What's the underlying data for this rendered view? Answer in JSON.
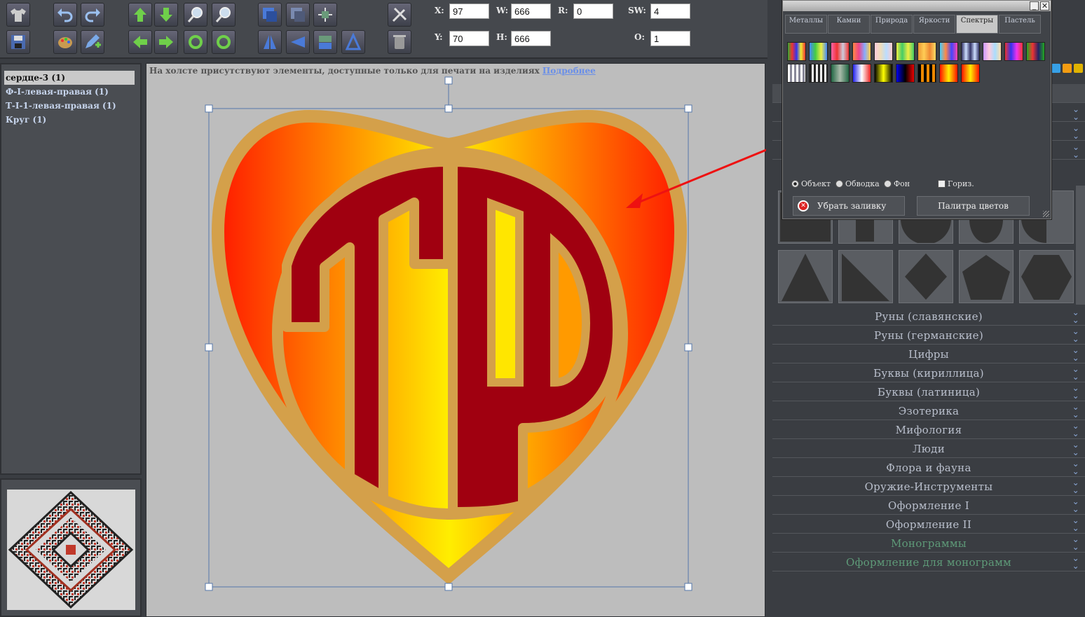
{
  "toolbar": {
    "fields": {
      "x": {
        "label": "X:",
        "value": "97"
      },
      "y": {
        "label": "Y:",
        "value": "70"
      },
      "w": {
        "label": "W:",
        "value": "666"
      },
      "h": {
        "label": "H:",
        "value": "666"
      },
      "r": {
        "label": "R:",
        "value": "0"
      },
      "sw": {
        "label": "SW:",
        "value": "4"
      },
      "o": {
        "label": "O:",
        "value": "1"
      }
    },
    "icons": [
      "shirt-icon",
      "undo-icon",
      "redo-icon",
      "move-up-icon",
      "move-down-icon",
      "zoom-in-icon",
      "zoom-out-icon",
      "bring-front-icon",
      "send-back-icon",
      "align-icon",
      "tools-icon",
      "save-icon",
      "palette-icon",
      "edit-add-icon",
      "move-left-icon",
      "move-right-icon",
      "rotate-cw-icon",
      "rotate-ccw-icon",
      "flip-horizontal-icon",
      "flip-left-icon",
      "flip-vertical-icon",
      "flip-right-icon",
      "trash-icon"
    ]
  },
  "layers": {
    "items": [
      {
        "label": "сердце-3 (1)",
        "selected": true
      },
      {
        "label": "Ф-I-левая-правая (1)",
        "selected": false
      },
      {
        "label": "Т-I-1-левая-правая (1)",
        "selected": false
      },
      {
        "label": "Круг (1)",
        "selected": false
      }
    ]
  },
  "canvas": {
    "notice_text": "На холсте присутствуют элементы, доступные только для печати на изделиях",
    "notice_link": "Подробнее",
    "colors": {
      "outline": "#d4a04a",
      "monogram": "#a00010",
      "gradient_edge": "#ff1a00",
      "gradient_center": "#ffee00"
    }
  },
  "palette_popup": {
    "tabs": [
      {
        "label": "Металлы",
        "active": false
      },
      {
        "label": "Камни",
        "active": false
      },
      {
        "label": "Природа",
        "active": false
      },
      {
        "label": "Яркости",
        "active": false
      },
      {
        "label": "Спектры",
        "active": true
      },
      {
        "label": "Пастель",
        "active": false
      }
    ],
    "radio": {
      "object": "Объект",
      "stroke": "Обводка",
      "background": "Фон",
      "horizontal": "Гориз.",
      "selected": "object"
    },
    "remove_fill": "Убрать заливку",
    "color_palette": "Палитра цветов",
    "minimize": "_",
    "close": "✕"
  },
  "categories": [
    {
      "label": "Руны (славянские)",
      "color": "normal"
    },
    {
      "label": "Руны (германские)",
      "color": "normal"
    },
    {
      "label": "Цифры",
      "color": "normal"
    },
    {
      "label": "Буквы (кириллица)",
      "color": "normal"
    },
    {
      "label": "Буквы (латиница)",
      "color": "normal"
    },
    {
      "label": "Эзотерика",
      "color": "normal"
    },
    {
      "label": "Мифология",
      "color": "normal"
    },
    {
      "label": "Люди",
      "color": "normal"
    },
    {
      "label": "Флора и фауна",
      "color": "normal"
    },
    {
      "label": "Оружие-Инструменты",
      "color": "normal"
    },
    {
      "label": "Оформление I",
      "color": "normal"
    },
    {
      "label": "Оформление II",
      "color": "normal"
    },
    {
      "label": "Монограммы",
      "color": "green"
    },
    {
      "label": "Оформление для монограмм",
      "color": "green"
    }
  ]
}
